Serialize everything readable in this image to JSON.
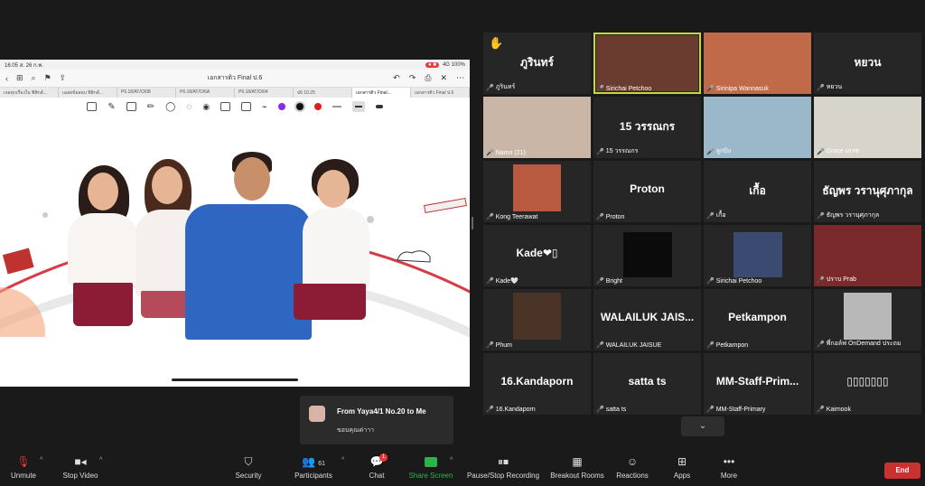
{
  "ipad": {
    "time": "16:05",
    "date": "ส. 26 ก.พ.",
    "status_right": "4G 100%",
    "doc_title": "เอกสารติว Final ป.6",
    "tabs": [
      "เจอทุกเรื่องใน ฟิสิกส์...",
      "เฉลยข้อสอบ ฟิสิกส์...",
      "P6.18/AT/O/08",
      "P6.18/AT/O/6A",
      "P6.18/AT/O/04",
      "ป6 10.25",
      "เอกสารติว Final...",
      "เอกสารติว Final ป.6"
    ],
    "active_tab": 6
  },
  "gallery": {
    "tiles": [
      {
        "big": "ภูรินทร์",
        "name": "ภูรินทร์",
        "hand": "✋"
      },
      {
        "big": "",
        "name": "Sirichai Petchoo",
        "speaker": true,
        "pic": "#6a3c30"
      },
      {
        "big": "",
        "name": "Sirinipa Wannasuk",
        "pic": "#c06a4a"
      },
      {
        "big": "หยวน",
        "name": "หยวน"
      },
      {
        "big": "",
        "name": "Namo (21)",
        "pic": "#c9b6a6"
      },
      {
        "big": "15 วรรณกร",
        "name": "15 วรรณกร"
      },
      {
        "big": "",
        "name": "ลูกปิง",
        "pic": "#9ab8c9"
      },
      {
        "big": "",
        "name": "Grace เกรซ",
        "pic": "#d7d4cc"
      },
      {
        "big": "",
        "name": "Kong Teerawat",
        "pic": "#b85a40"
      },
      {
        "big": "Proton",
        "name": "Proton"
      },
      {
        "big": "เกื้อ",
        "name": "เกื้อ"
      },
      {
        "big": "ธัญพร วรานุศุภากุล",
        "name": "ธัญพร วรานุศุภากุล"
      },
      {
        "big": "Kade❤▯",
        "name": "Kade🤍"
      },
      {
        "big": "",
        "name": "Bright",
        "pic": "#0b0b0b"
      },
      {
        "big": "",
        "name": "Sirichai Petchoo",
        "pic": "#3a4a70"
      },
      {
        "big": "",
        "name": "ปราบ Prab",
        "pic": "#7a2a2a"
      },
      {
        "big": "",
        "name": "Phum",
        "pic": "#4a3428"
      },
      {
        "big": "WALAILUK JAIS...",
        "name": "WALAILUK JAISUE"
      },
      {
        "big": "Petkampon",
        "name": "Petkampon"
      },
      {
        "big": "",
        "name": "พี่กอล์ฟ OnDemand ประถม",
        "pic": "#b8b8b8"
      },
      {
        "big": "16.Kandaporn",
        "name": "16.Kandaporn"
      },
      {
        "big": "satta ts",
        "name": "satta ts"
      },
      {
        "big": "MM-Staff-Prim...",
        "name": "MM-Staff-Primary"
      },
      {
        "big": "▯▯▯▯▯▯▯",
        "name": "Kaimook"
      }
    ]
  },
  "chat_popup": {
    "from": "From Yaya4/1 No.20 to Me",
    "message": "ขอบคุณค่าาา"
  },
  "toolbar": {
    "unmute": "Unmute",
    "stop_video": "Stop Video",
    "security": "Security",
    "participants": "Participants",
    "participants_count": "61",
    "chat": "Chat",
    "chat_badge": "1",
    "share_screen": "Share Screen",
    "recording": "Pause/Stop Recording",
    "breakout": "Breakout Rooms",
    "reactions": "Reactions",
    "apps": "Apps",
    "more": "More",
    "end": "End"
  },
  "colors": {
    "share_green": "#2eb24a",
    "end_red": "#c8332f",
    "speaker_outline": "#c7d936"
  }
}
